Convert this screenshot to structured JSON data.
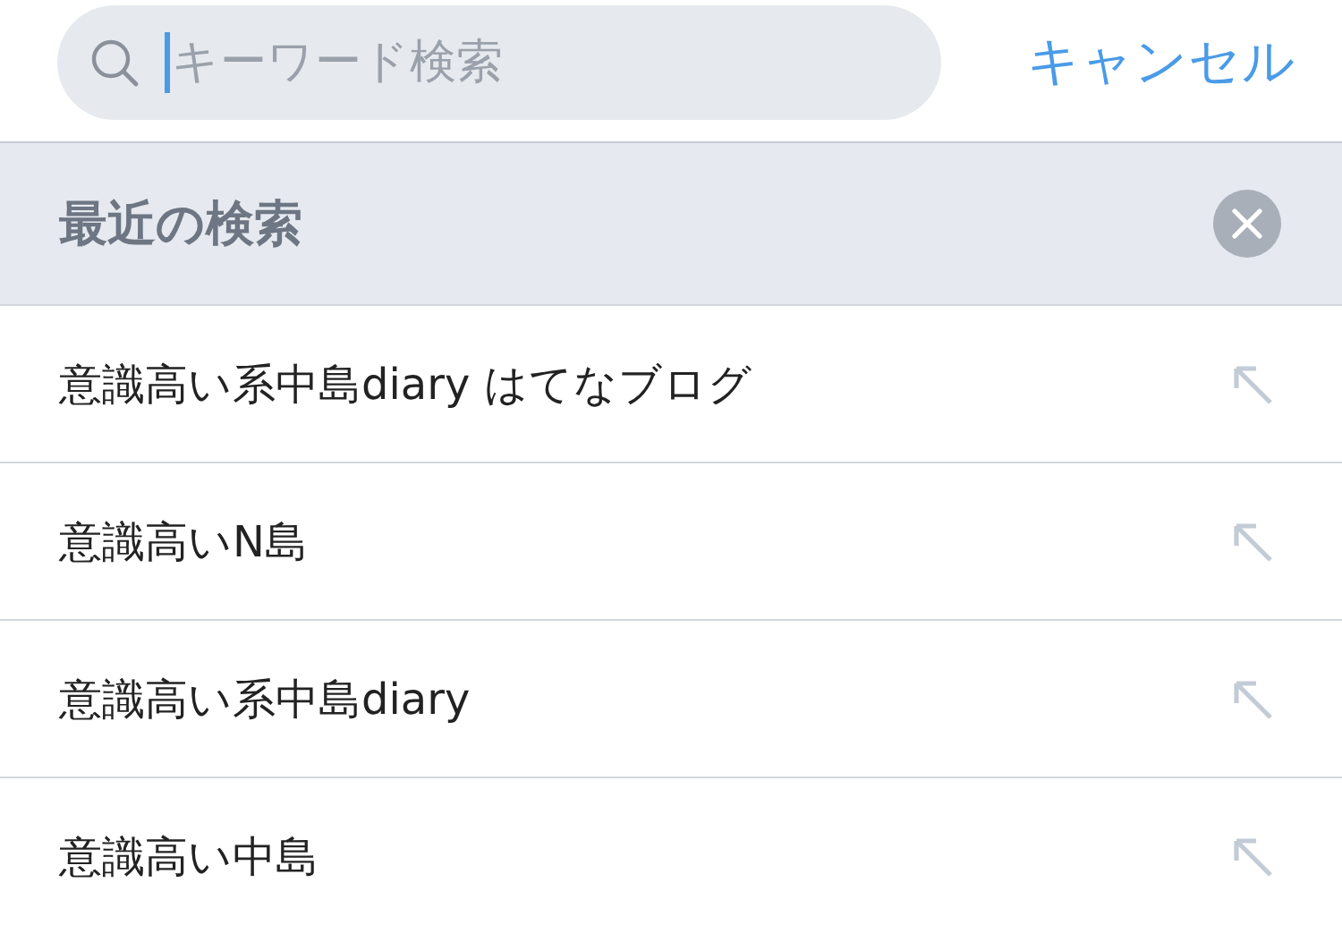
{
  "search": {
    "placeholder": "キーワード検索",
    "focused": true
  },
  "cancel_button": "キャンセル",
  "recent_header": {
    "title": "最近の検索"
  },
  "recent_searches": [
    {
      "text": "意識高い系中島diary はてなブログ"
    },
    {
      "text": "意識高いN島"
    },
    {
      "text": "意識高い系中島diary"
    },
    {
      "text": "意識高い中島"
    }
  ]
}
